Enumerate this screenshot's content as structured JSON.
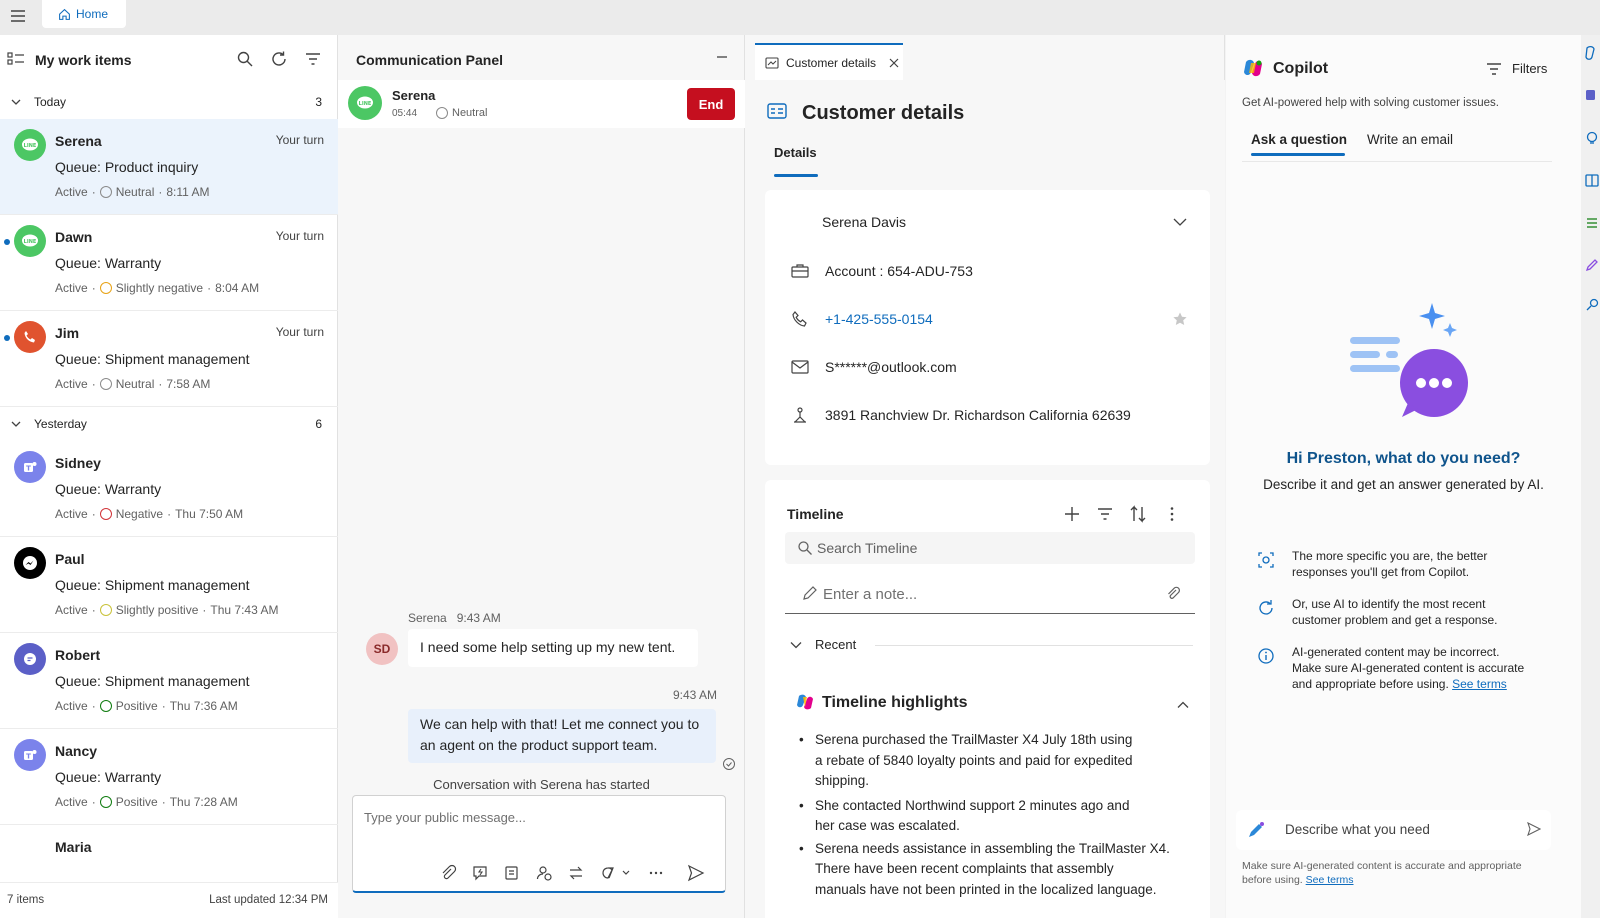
{
  "topbar": {
    "home_tab": "Home"
  },
  "work_items": {
    "title": "My work items",
    "groups": [
      {
        "label": "Today",
        "count": "3"
      },
      {
        "label": "Yesterday",
        "count": "6"
      }
    ],
    "items": [
      {
        "name": "Serena",
        "queue": "Queue: Product inquiry",
        "status": "Active",
        "sentiment": "Neutral",
        "time": "8:11 AM",
        "turn": "Your turn",
        "channel": "line",
        "color": "#4cc764"
      },
      {
        "name": "Dawn",
        "queue": "Queue: Warranty",
        "status": "Active",
        "sentiment": "Slightly negative",
        "time": "8:04 AM",
        "turn": "Your turn",
        "channel": "line",
        "color": "#4cc764"
      },
      {
        "name": "Jim",
        "queue": "Queue: Shipment management",
        "status": "Active",
        "sentiment": "Neutral",
        "time": "7:58 AM",
        "turn": "Your turn",
        "channel": "phone",
        "color": "#e0532f"
      },
      {
        "name": "Sidney",
        "queue": "Queue: Warranty",
        "status": "Active",
        "sentiment": "Negative",
        "time": "Thu 7:50 AM",
        "channel": "teams",
        "color": "#7b83eb"
      },
      {
        "name": "Paul",
        "queue": "Queue: Shipment management",
        "status": "Active",
        "sentiment": "Slightly positive",
        "time": "Thu 7:43 AM",
        "channel": "messenger",
        "color": "#000000"
      },
      {
        "name": "Robert",
        "queue": "Queue: Shipment management",
        "status": "Active",
        "sentiment": "Positive",
        "time": "Thu 7:36 AM",
        "channel": "chat",
        "color": "#5b5fc7"
      },
      {
        "name": "Nancy",
        "queue": "Queue: Warranty",
        "status": "Active",
        "sentiment": "Positive",
        "time": "Thu 7:28 AM",
        "channel": "teams",
        "color": "#7b83eb"
      },
      {
        "name": "Maria"
      }
    ],
    "footer_count": "7 items",
    "footer_updated": "Last updated 12:34 PM"
  },
  "comm_panel": {
    "title": "Communication Panel",
    "contact_name": "Serena",
    "contact_timer": "05:44",
    "contact_sentiment": "Neutral",
    "end_label": "End",
    "messages": [
      {
        "sender": "Serena",
        "time": "9:43 AM",
        "initials": "SD",
        "text": "I need some help setting up my new tent."
      },
      {
        "time": "9:43 AM",
        "text_line1": "We can help with that! Let me connect you to",
        "text_line2": "an agent on the product support team."
      }
    ],
    "system_msg": "Conversation with Serena has started",
    "composer_placeholder": "Type your public message..."
  },
  "customer": {
    "tab_label": "Customer details",
    "title": "Customer details",
    "subtab": "Details",
    "name": "Serena Davis",
    "account": "Account : 654-ADU-753",
    "phone": "+1-425-555-0154",
    "email": "S******@outlook.com",
    "address": "3891 Ranchview Dr. Richardson California 62639",
    "timeline": {
      "title": "Timeline",
      "search_placeholder": "Search Timeline",
      "note_placeholder": "Enter a note...",
      "recent": "Recent",
      "highlights_title": "Timeline highlights",
      "highlights": [
        {
          "l1": "Serena purchased the TrailMaster X4 July 18th using",
          "l2": "a rebate of 5840 loyalty points and paid for expedited",
          "l3": "shipping."
        },
        {
          "l1": "She contacted Northwind support 2 minutes ago and",
          "l2": "her case was escalated."
        },
        {
          "l1": "Serena needs assistance in assembling the TrailMaster X4.",
          "l2": "There have been recent complaints that assembly",
          "l3": "manuals have not been printed in the localized language."
        }
      ]
    }
  },
  "copilot": {
    "title": "Copilot",
    "filters": "Filters",
    "subtitle": "Get AI-powered help with solving customer issues.",
    "tabs": [
      "Ask a question",
      "Write an email"
    ],
    "greeting": "Hi Preston, what do you need?",
    "greeting_sub": "Describe it and get an answer generated by AI.",
    "tips": [
      {
        "l1": "The more specific you are, the better",
        "l2": "responses you'll get from Copilot."
      },
      {
        "l1": "Or, use AI to identify the most recent",
        "l2": "customer problem and get a response."
      },
      {
        "l1": "AI-generated content may be incorrect.",
        "l2": "Make sure AI-generated content is accurate",
        "l3": "and appropriate before using.",
        "link": "See terms"
      }
    ],
    "input_placeholder": "Describe what you need",
    "disclaimer_l1": "Make sure AI-generated content is accurate and appropriate",
    "disclaimer_l2": "before using.",
    "disclaimer_link": "See terms"
  },
  "colors": {
    "accent": "#0f6cbd",
    "end": "#c50f1f",
    "selected_row": "#ebf3fc",
    "copilot_heading": "#0f548c"
  }
}
